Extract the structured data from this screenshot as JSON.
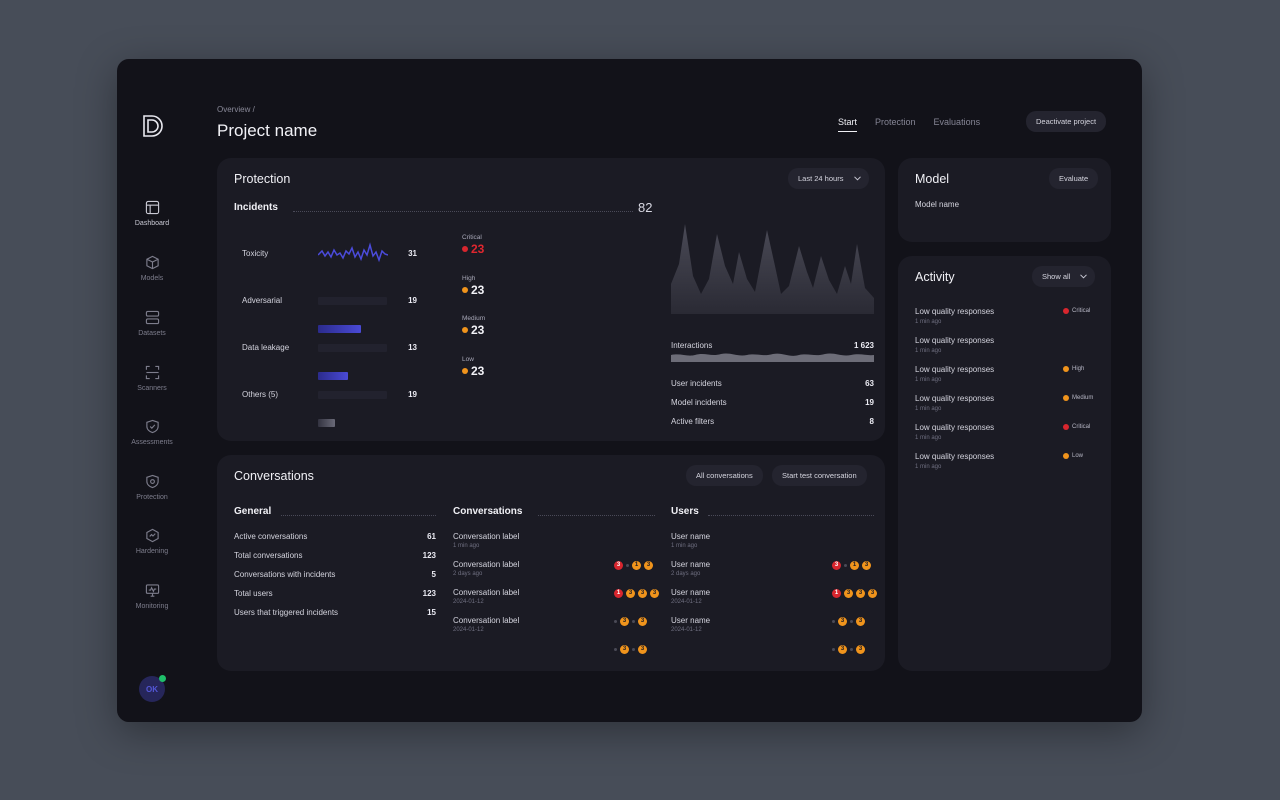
{
  "colors": {
    "critical": "#d8262e",
    "high": "#f0941c",
    "medium": "#f0941c",
    "low": "#f0941c",
    "accent": "#4a4ad6",
    "online": "#1fbf6a"
  },
  "sidebar": {
    "items": [
      {
        "label": "Dashboard",
        "icon": "dashboard-icon"
      },
      {
        "label": "Models",
        "icon": "cube-icon"
      },
      {
        "label": "Datasets",
        "icon": "database-icon"
      },
      {
        "label": "Scanners",
        "icon": "scan-icon"
      },
      {
        "label": "Assessments",
        "icon": "shield-check-icon"
      },
      {
        "label": "Protection",
        "icon": "shield-icon"
      },
      {
        "label": "Hardening",
        "icon": "hexagon-icon"
      },
      {
        "label": "Monitoring",
        "icon": "monitor-icon"
      }
    ],
    "avatar": "OK"
  },
  "header": {
    "breadcrumb": "Overview /",
    "title": "Project name",
    "tabs": [
      "Start",
      "Protection",
      "Evaluations"
    ],
    "deactivate": "Deactivate project"
  },
  "protection": {
    "title": "Protection",
    "range": "Last 24 hours",
    "incidents_label": "Incidents",
    "incidents_total": "82",
    "categories": [
      {
        "label": "Toxicity",
        "value": "31",
        "fill": null
      },
      {
        "label": "Adversarial",
        "value": "19",
        "fill": 0.62
      },
      {
        "label": "Data leakage",
        "value": "13",
        "fill": 0.43
      },
      {
        "label": "Others (5)",
        "value": "19",
        "fill": 0.24
      }
    ],
    "severity": [
      {
        "label": "Critical",
        "value": "23"
      },
      {
        "label": "High",
        "value": "23"
      },
      {
        "label": "Medium",
        "value": "23"
      },
      {
        "label": "Low",
        "value": "23"
      }
    ],
    "interactions_label": "Interactions",
    "interactions_value": "1 623",
    "stats": [
      {
        "label": "User incidents",
        "value": "63"
      },
      {
        "label": "Model incidents",
        "value": "19"
      },
      {
        "label": "Active filters",
        "value": "8"
      }
    ]
  },
  "model": {
    "title": "Model",
    "evaluate": "Evaluate",
    "name": "Model name"
  },
  "activity": {
    "title": "Activity",
    "filter": "Show all",
    "items": [
      {
        "title": "Low quality responses",
        "time": "1 min ago",
        "severity": "Critical",
        "color": "#d8262e"
      },
      {
        "title": "Low quality responses",
        "time": "1 min ago",
        "severity": "",
        "color": ""
      },
      {
        "title": "Low quality responses",
        "time": "1 min ago",
        "severity": "High",
        "color": "#f0941c"
      },
      {
        "title": "Low quality responses",
        "time": "1 min ago",
        "severity": "Medium",
        "color": "#f0941c"
      },
      {
        "title": "Low quality responses",
        "time": "1 min ago",
        "severity": "Critical",
        "color": "#d8262e"
      },
      {
        "title": "Low quality responses",
        "time": "1 min ago",
        "severity": "Low",
        "color": "#f0941c"
      }
    ]
  },
  "conversations": {
    "title": "Conversations",
    "all_button": "All conversations",
    "start_button": "Start test conversation",
    "general": {
      "heading": "General",
      "rows": [
        {
          "label": "Active conversations",
          "value": "61"
        },
        {
          "label": "Total conversations",
          "value": "123"
        },
        {
          "label": "Conversations with incidents",
          "value": "5"
        },
        {
          "label": "Total users",
          "value": "123"
        },
        {
          "label": "Users that triggered incidents",
          "value": "15"
        }
      ]
    },
    "list": {
      "heading": "Conversations",
      "items": [
        {
          "label": "Conversation label",
          "time": "1 min ago",
          "badges": []
        },
        {
          "label": "Conversation label",
          "time": "2 days ago",
          "badges": [
            "3",
            "",
            "1",
            "3"
          ]
        },
        {
          "label": "Conversation label",
          "time": "2024-01-12",
          "badges": [
            "1",
            "3",
            "3",
            "3"
          ]
        },
        {
          "label": "Conversation label",
          "time": "2024-01-12",
          "badges": [
            "",
            "3",
            "",
            "3"
          ]
        },
        {
          "label": "",
          "time": "",
          "badges": [
            "",
            "3",
            "",
            "3"
          ]
        }
      ]
    },
    "users": {
      "heading": "Users",
      "items": [
        {
          "label": "User name",
          "time": "1 min ago",
          "badges": []
        },
        {
          "label": "User name",
          "time": "2 days ago",
          "badges": [
            "3",
            "",
            "1",
            "3"
          ]
        },
        {
          "label": "User name",
          "time": "2024-01-12",
          "badges": [
            "1",
            "3",
            "3",
            "3"
          ]
        },
        {
          "label": "User name",
          "time": "2024-01-12",
          "badges": [
            "",
            "3",
            "",
            "3"
          ]
        },
        {
          "label": "",
          "time": "",
          "badges": [
            "",
            "3",
            "",
            "3"
          ]
        }
      ]
    }
  }
}
